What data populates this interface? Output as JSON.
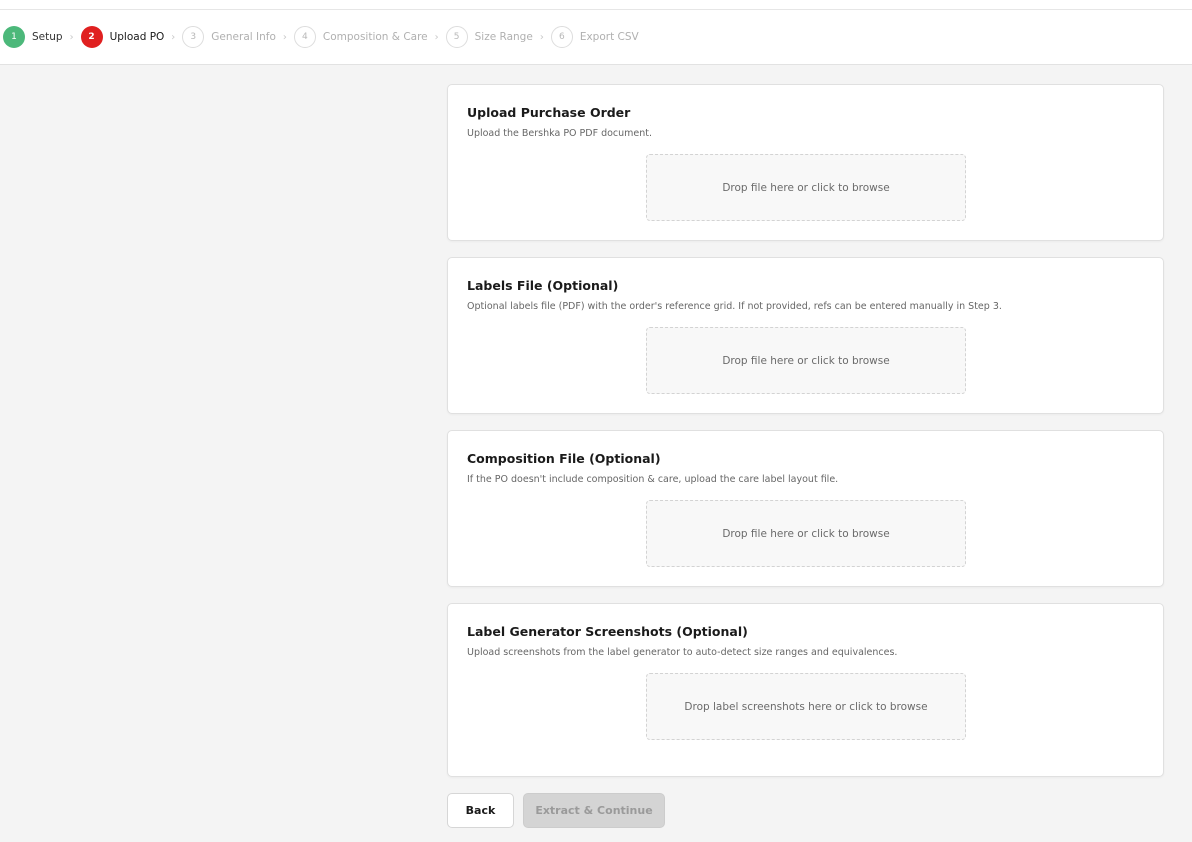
{
  "stepper": {
    "steps": [
      {
        "num": "1",
        "label": "Setup",
        "state": "done"
      },
      {
        "num": "2",
        "label": "Upload PO",
        "state": "active"
      },
      {
        "num": "3",
        "label": "General Info",
        "state": "todo"
      },
      {
        "num": "4",
        "label": "Composition & Care",
        "state": "todo"
      },
      {
        "num": "5",
        "label": "Size Range",
        "state": "todo"
      },
      {
        "num": "6",
        "label": "Export CSV",
        "state": "todo"
      }
    ],
    "separator": "›",
    "colors": {
      "done": "#4cb87a",
      "active": "#e02020",
      "todo": "#b0b0b0"
    }
  },
  "cards": [
    {
      "title": "Upload Purchase Order",
      "desc": "Upload the Bershka PO PDF document.",
      "dropzone": "Drop file here or click to browse"
    },
    {
      "title": "Labels File (Optional)",
      "desc": "Optional labels file (PDF) with the order's reference grid. If not provided, refs can be entered manually in Step 3.",
      "dropzone": "Drop file here or click to browse"
    },
    {
      "title": "Composition File (Optional)",
      "desc": "If the PO doesn't include composition & care, upload the care label layout file.",
      "dropzone": "Drop file here or click to browse"
    },
    {
      "title": "Label Generator Screenshots (Optional)",
      "desc": "Upload screenshots from the label generator to auto-detect size ranges and equivalences.",
      "dropzone": "Drop label screenshots here or click to browse"
    }
  ],
  "actions": {
    "back_label": "Back",
    "continue_label": "Extract & Continue",
    "continue_disabled": true
  }
}
